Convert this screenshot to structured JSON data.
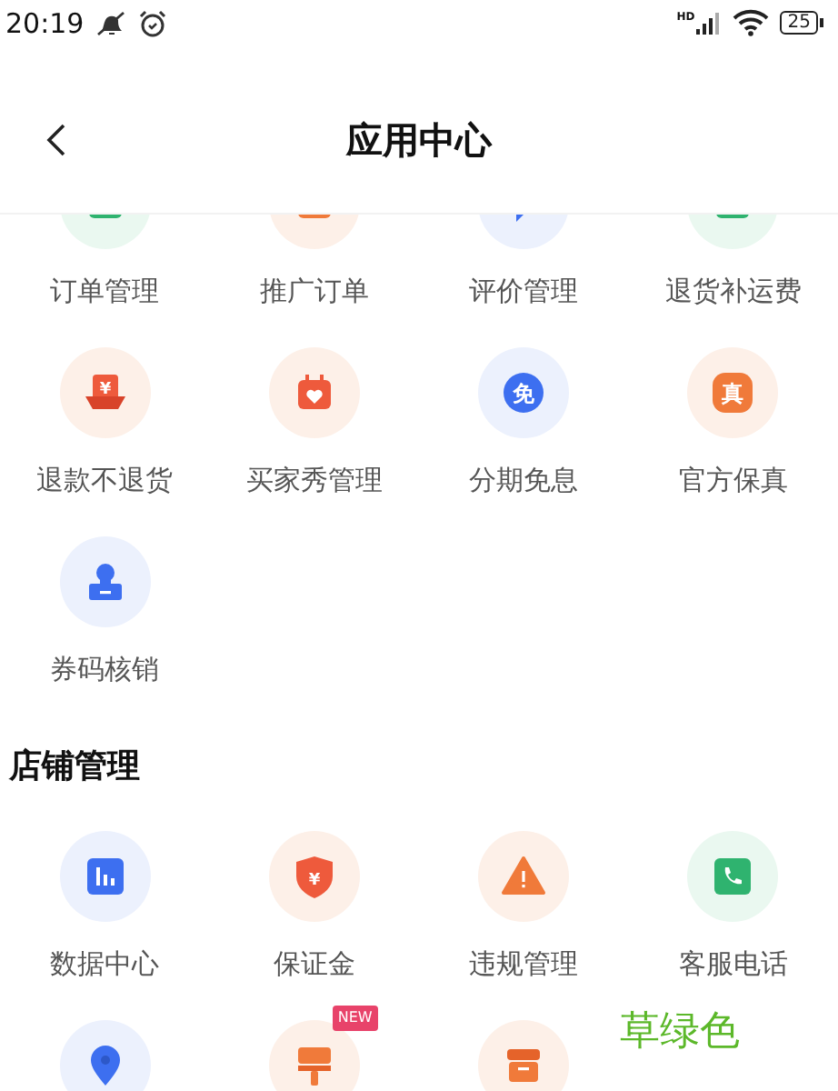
{
  "status_bar": {
    "time": "20:19",
    "network": "HD",
    "battery": "25"
  },
  "header": {
    "title": "应用中心"
  },
  "sections": [
    {
      "items": [
        {
          "label": "订单管理",
          "kind": "order"
        },
        {
          "label": "推广订单",
          "kind": "promo"
        },
        {
          "label": "评价管理",
          "kind": "review"
        },
        {
          "label": "退货补运费",
          "kind": "return-fee"
        },
        {
          "label": "退款不退货",
          "kind": "refund",
          "glyph": "¥"
        },
        {
          "label": "买家秀管理",
          "kind": "buyer-show"
        },
        {
          "label": "分期免息",
          "kind": "installment",
          "glyph": "免"
        },
        {
          "label": "官方保真",
          "kind": "authentic",
          "glyph": "真"
        },
        {
          "label": "券码核销",
          "kind": "coupon"
        }
      ]
    },
    {
      "title": "店铺管理",
      "items": [
        {
          "label": "数据中心",
          "kind": "data"
        },
        {
          "label": "保证金",
          "kind": "deposit",
          "glyph": "¥"
        },
        {
          "label": "违规管理",
          "kind": "violation"
        },
        {
          "label": "客服电话",
          "kind": "phone"
        },
        {
          "kind": "location"
        },
        {
          "kind": "decorate",
          "badge": "NEW"
        },
        {
          "kind": "storage"
        }
      ]
    }
  ],
  "overlay_caption": "草绿色"
}
